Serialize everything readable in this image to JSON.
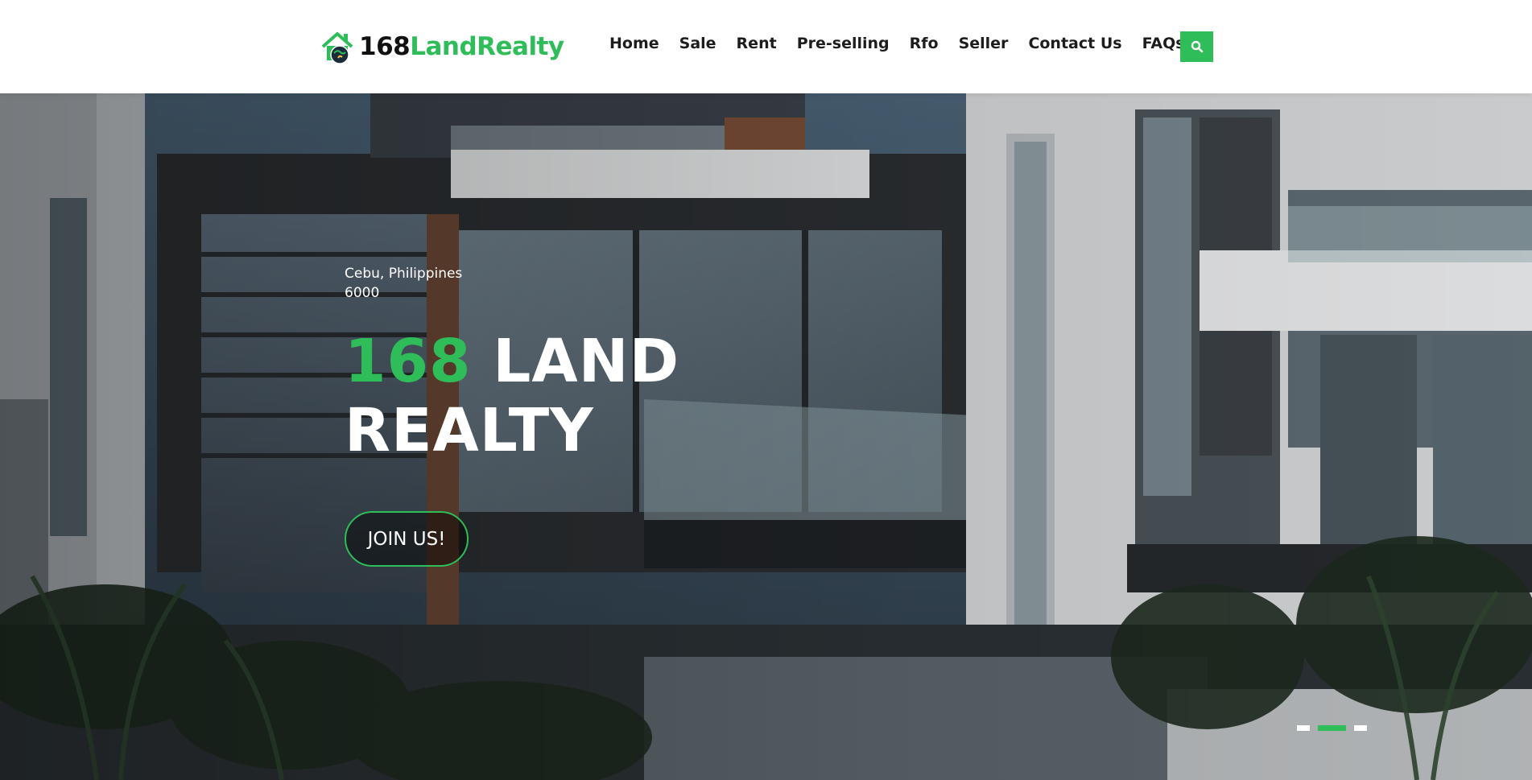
{
  "brand": {
    "name_part1": "168",
    "name_part2": "LandRealty",
    "logo_icon": "house-logo-icon",
    "accent_color": "#2ebd59"
  },
  "nav": {
    "items": [
      {
        "label": "Home"
      },
      {
        "label": "Sale"
      },
      {
        "label": "Rent"
      },
      {
        "label": "Pre-selling"
      },
      {
        "label": "Rfo"
      },
      {
        "label": "Seller"
      },
      {
        "label": "Contact Us"
      },
      {
        "label": "FAQs"
      }
    ],
    "search_icon": "search-icon"
  },
  "hero": {
    "location_line1": "Cebu, Philippines",
    "location_line2": "6000",
    "title_accent": "168",
    "title_rest": "LAND",
    "title_line2": "REALTY",
    "cta_label": "JOIN US!",
    "slides": {
      "count": 3,
      "active_index": 1
    }
  }
}
